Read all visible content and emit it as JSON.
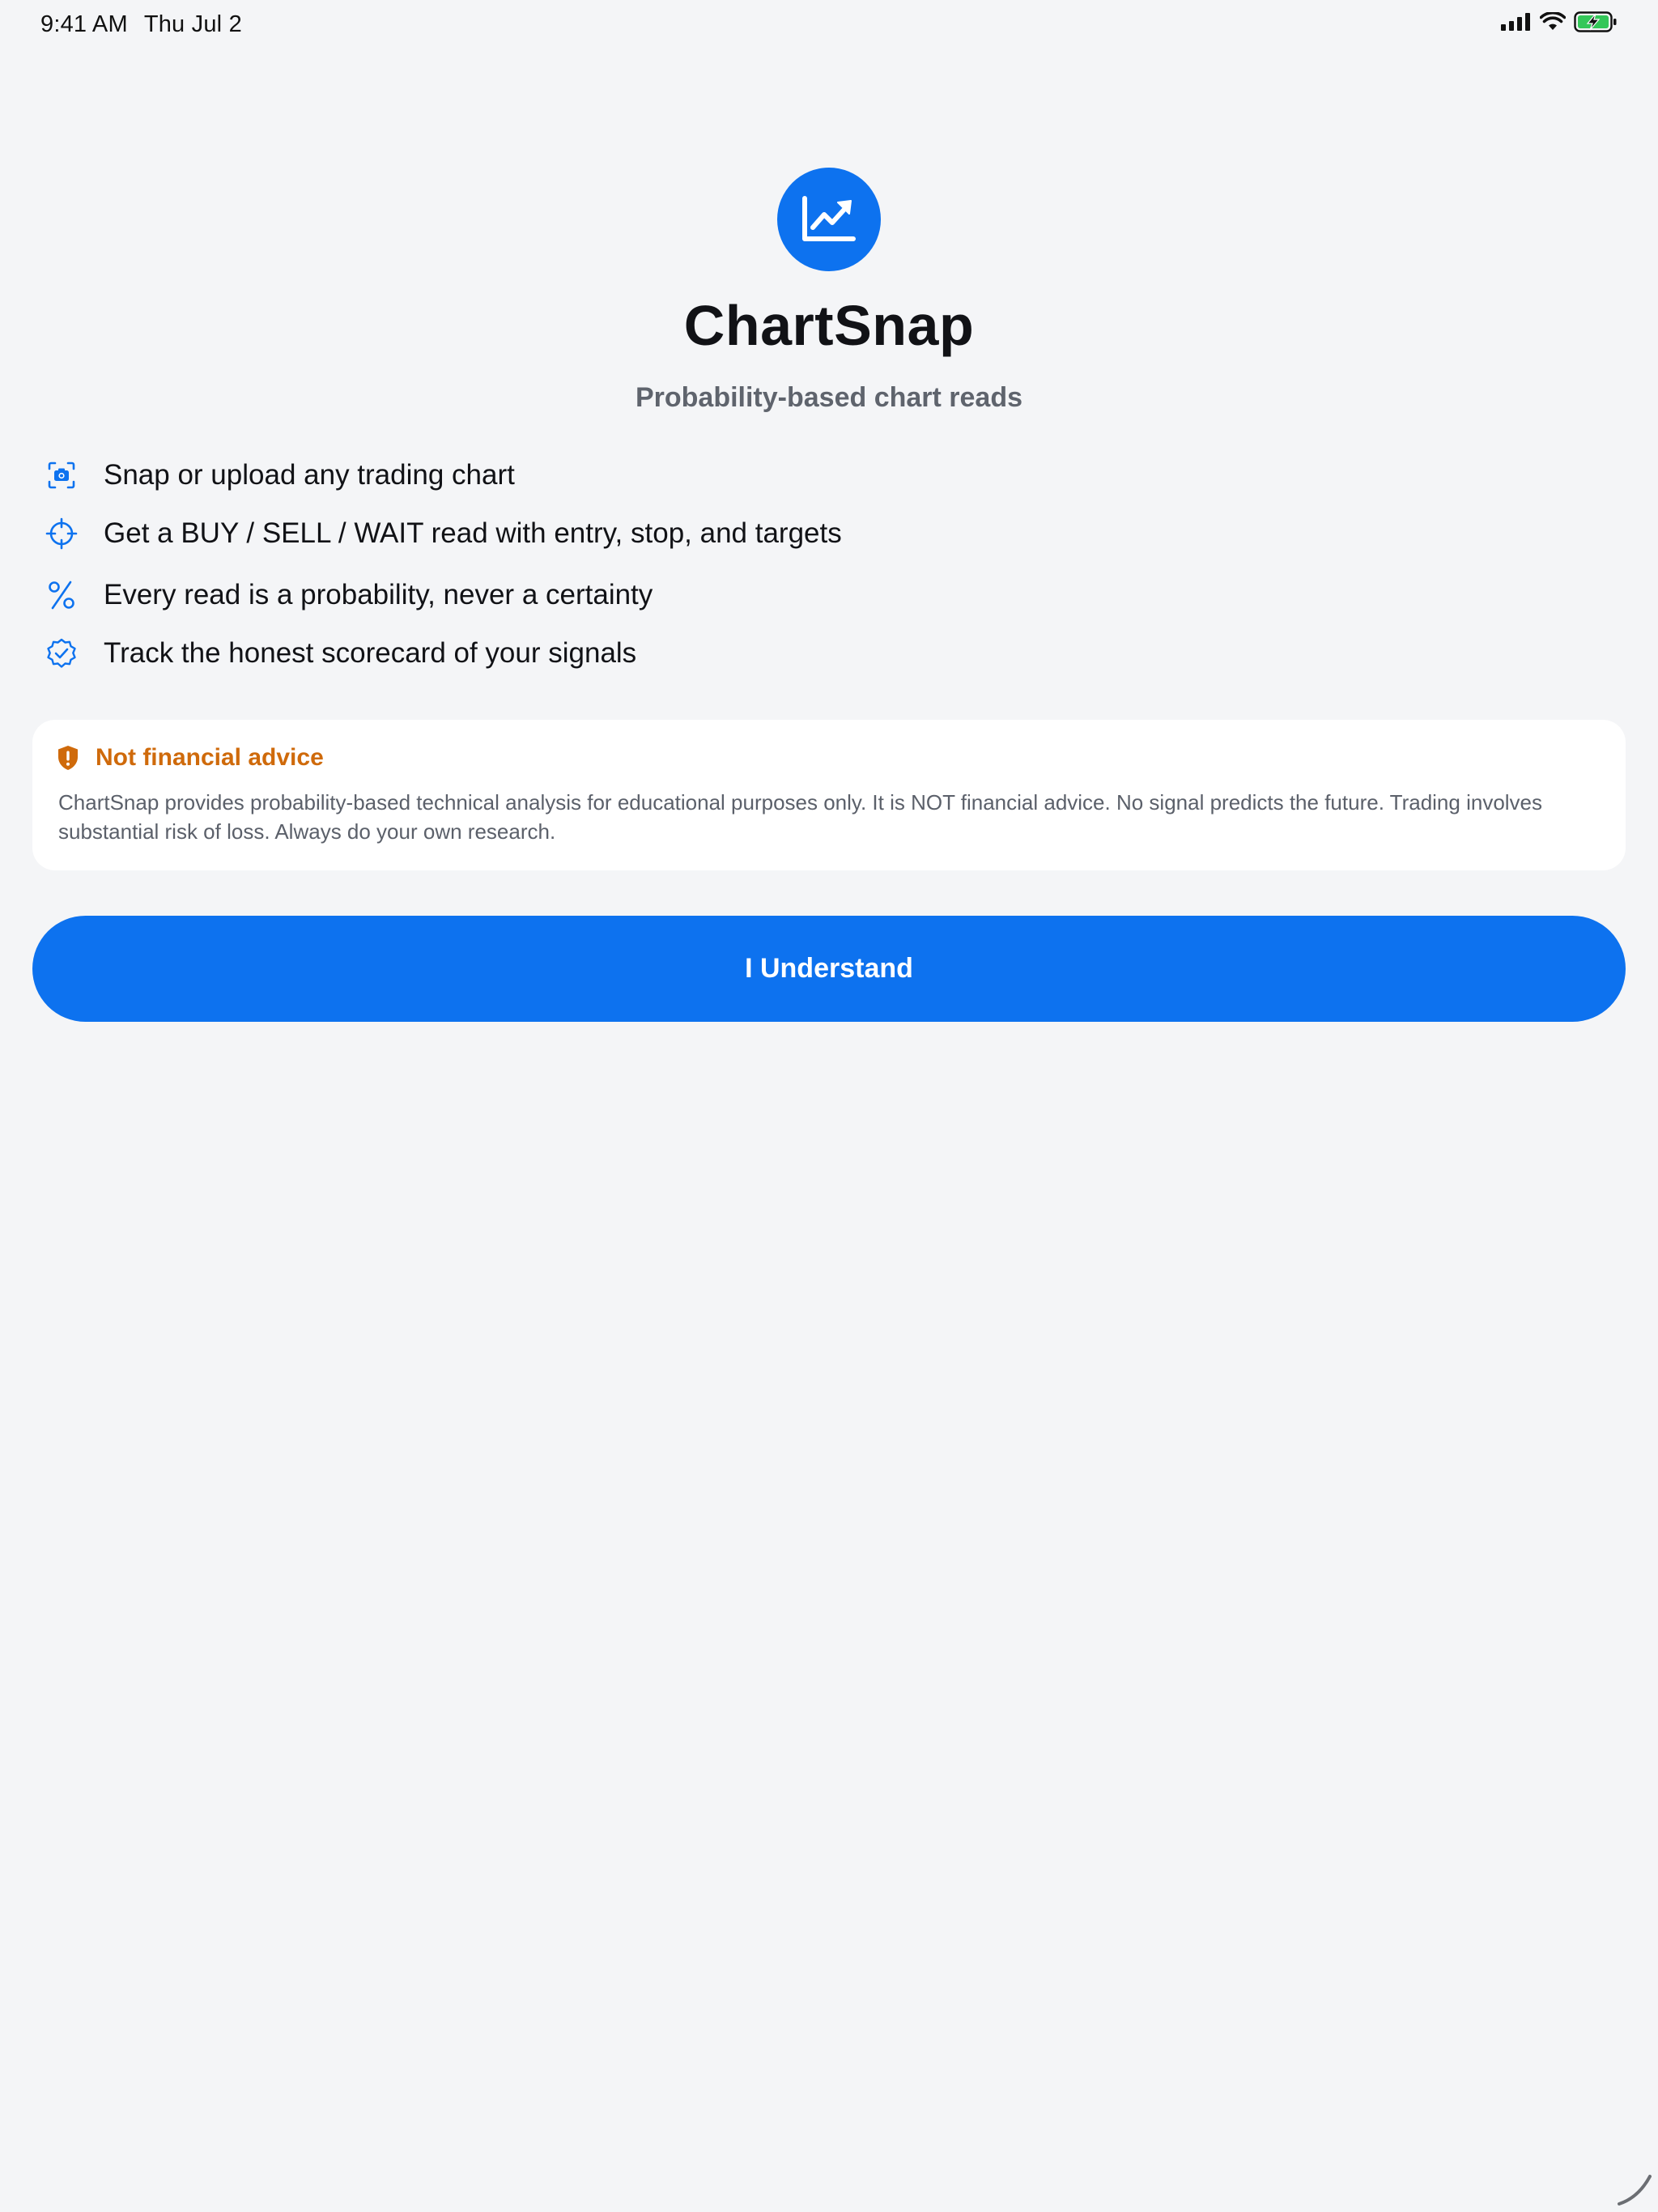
{
  "status_bar": {
    "time": "9:41 AM",
    "date": "Thu Jul 2",
    "icons": [
      "cellular-signal-icon",
      "wifi-icon",
      "battery-charging-icon"
    ]
  },
  "app": {
    "icon": "chart-line-up-icon",
    "title": "ChartSnap",
    "subtitle": "Probability-based chart reads"
  },
  "features": [
    {
      "icon": "camera-viewfinder-icon",
      "text": "Snap or upload any trading chart"
    },
    {
      "icon": "crosshair-icon",
      "text": "Get a BUY / SELL / WAIT read with entry, stop, and targets"
    },
    {
      "icon": "percent-icon",
      "text": "Every read is a probability, never a certainty"
    },
    {
      "icon": "checkmark-seal-icon",
      "text": "Track the honest scorecard of your signals"
    }
  ],
  "disclaimer": {
    "icon": "shield-exclamation-icon",
    "title": "Not financial advice",
    "body": "ChartSnap provides probability-based technical analysis for educational purposes only. It is NOT financial advice. No signal predicts the future. Trading involves substantial risk of loss. Always do your own research."
  },
  "actions": {
    "understand_label": "I Understand"
  },
  "colors": {
    "background": "#f4f5f7",
    "accent": "#0d72ef",
    "warning": "#cf6a0b",
    "text_primary": "#111216",
    "text_secondary": "#5f646d"
  }
}
